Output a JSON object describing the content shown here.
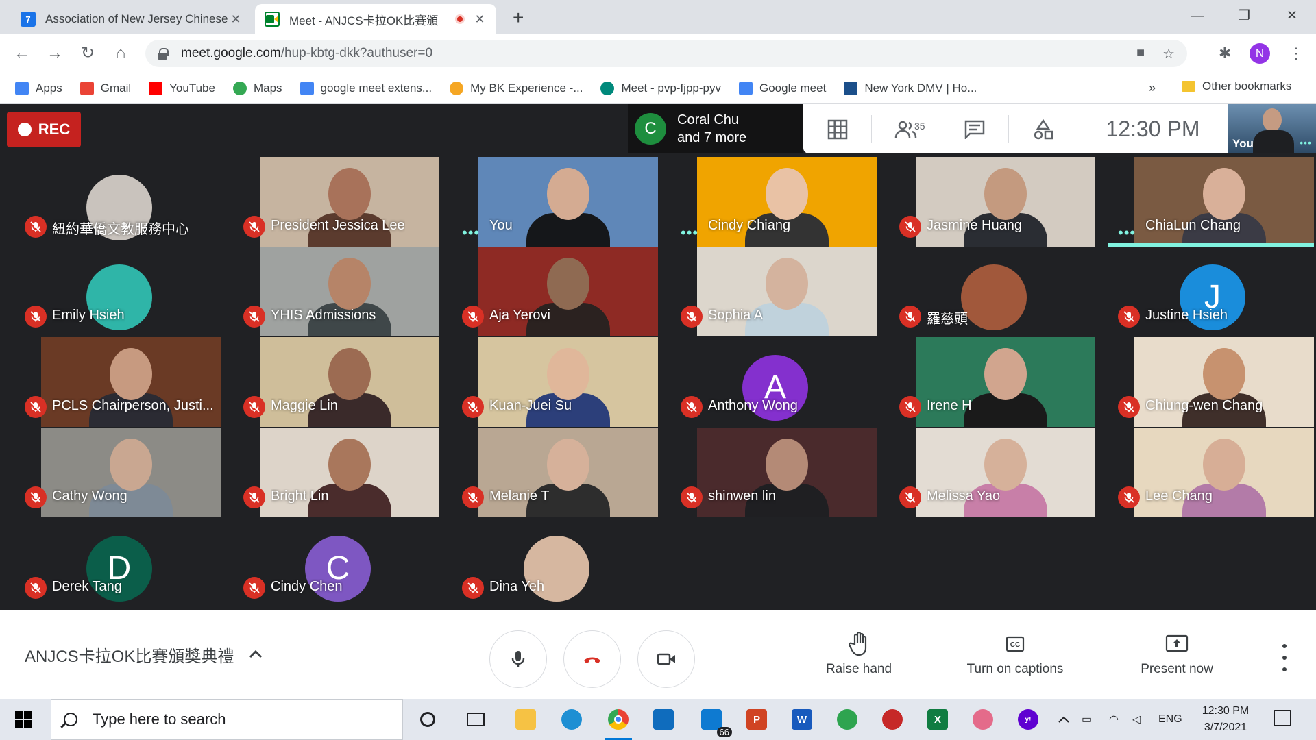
{
  "browser": {
    "tabs": [
      {
        "title": "Association of New Jersey Chinese",
        "favicon_text": "7",
        "favicon_color": "#1a73e8"
      },
      {
        "title": "Meet - ANJCS卡拉OK比賽頒",
        "favicon_text": "",
        "favicon_color": "#00832d"
      }
    ],
    "url_host": "meet.google.com",
    "url_path": "/hup-kbtg-dkk?authuser=0",
    "profile_initial": "N"
  },
  "bookmarks": [
    {
      "label": "Apps",
      "icon": "apps-grid-icon",
      "color": "#4285f4"
    },
    {
      "label": "Gmail",
      "icon": "gmail-icon",
      "color": "#ea4335"
    },
    {
      "label": "YouTube",
      "icon": "youtube-icon",
      "color": "#ff0000"
    },
    {
      "label": "Maps",
      "icon": "maps-pin-icon",
      "color": "#34a853"
    },
    {
      "label": "google meet extens...",
      "icon": "google-g-icon",
      "color": "#4285f4"
    },
    {
      "label": "My BK Experience -...",
      "icon": "bk-icon",
      "color": "#f5a623"
    },
    {
      "label": "Meet - pvp-fjpp-pyv",
      "icon": "meet-icon",
      "color": "#00897b"
    },
    {
      "label": "Google meet",
      "icon": "google-g-icon",
      "color": "#4285f4"
    },
    {
      "label": "New York DMV | Ho...",
      "icon": "ny-dmv-icon",
      "color": "#1b4f8a"
    }
  ],
  "bookmarks_more": "»",
  "other_bookmarks": "Other bookmarks",
  "meet": {
    "rec_label": "REC",
    "presenter": {
      "initial": "C",
      "line1": "Coral Chu",
      "line2": "and 7 more"
    },
    "participant_count": "35",
    "clock": "12:30  PM",
    "self_label": "You",
    "participants": [
      {
        "name": "紐約華僑文教服務中心",
        "state": "muted",
        "kind": "circle-photo",
        "color": "#c9c3bd"
      },
      {
        "name": "President Jessica Lee",
        "state": "muted",
        "kind": "video",
        "color": "#c6b4a0",
        "skin": "#a8725a",
        "shirt": "#5b3b2e"
      },
      {
        "name": "You",
        "state": "speaking",
        "kind": "video",
        "color": "#5f87b8",
        "skin": "#d4ab92",
        "shirt": "#15171a"
      },
      {
        "name": "Cindy Chiang",
        "state": "speaking",
        "kind": "video",
        "color": "#f0a400",
        "skin": "#e9c2a5",
        "shirt": "#333333"
      },
      {
        "name": "Jasmine Huang",
        "state": "muted",
        "kind": "video",
        "color": "#d3cbc1",
        "skin": "#c49a7f",
        "shirt": "#2a2d33"
      },
      {
        "name": "ChiaLun Chang",
        "state": "speaking-active",
        "kind": "video",
        "color": "#7a5a42",
        "skin": "#d9b099",
        "shirt": "#3b3b45"
      },
      {
        "name": "Emily Hsieh",
        "state": "muted",
        "kind": "circle-photo",
        "color": "#2fb5a8"
      },
      {
        "name": "YHIS Admissions",
        "state": "muted",
        "kind": "video",
        "color": "#9fa2a0",
        "skin": "#b68468",
        "shirt": "#3f4749"
      },
      {
        "name": "Aja Yerovi",
        "state": "muted",
        "kind": "video",
        "color": "#8e2a24",
        "skin": "#8f6a52",
        "shirt": "#2b2220"
      },
      {
        "name": "Sophia A",
        "state": "muted",
        "kind": "video",
        "color": "#dcd6cc",
        "skin": "#d4b39e",
        "shirt": "#c0d2dc"
      },
      {
        "name": "羅慈頭",
        "state": "muted",
        "kind": "circle-photo",
        "color": "#a1583b"
      },
      {
        "name": "Justine Hsieh",
        "state": "muted",
        "kind": "avatar",
        "color": "#1a8ddb",
        "initial": "J"
      },
      {
        "name": "PCLS Chairperson, Justi...",
        "state": "muted",
        "kind": "video",
        "color": "#6a3a25",
        "skin": "#c79a80",
        "shirt": "#2b2b33"
      },
      {
        "name": "Maggie Lin",
        "state": "muted",
        "kind": "video",
        "color": "#cfbe9a",
        "skin": "#9c6b52",
        "shirt": "#3a2a2a"
      },
      {
        "name": "Kuan-Juei Su",
        "state": "muted",
        "kind": "video",
        "color": "#d6c59f",
        "skin": "#e0b79a",
        "shirt": "#2c3f7a"
      },
      {
        "name": "Anthony Wong",
        "state": "muted",
        "kind": "avatar",
        "color": "#8430ce",
        "initial": "A"
      },
      {
        "name": "Irene H",
        "state": "muted",
        "kind": "video",
        "color": "#2c7a5a",
        "skin": "#d1a58e",
        "shirt": "#1a1a1a"
      },
      {
        "name": "Chiung-wen Chang",
        "state": "muted",
        "kind": "video",
        "color": "#e8dccb",
        "skin": "#c7926f",
        "shirt": "#3f2f2a"
      },
      {
        "name": "Cathy Wong",
        "state": "muted",
        "kind": "video",
        "color": "#8c8b86",
        "skin": "#c9a791",
        "shirt": "#7e8a96"
      },
      {
        "name": "Bright Lin",
        "state": "muted",
        "kind": "video",
        "color": "#ddd4c9",
        "skin": "#a9775c",
        "shirt": "#4a2c2c"
      },
      {
        "name": "Melanie T",
        "state": "muted",
        "kind": "video",
        "color": "#b9a793",
        "skin": "#d6b19a",
        "shirt": "#2d2d2d"
      },
      {
        "name": "shinwen lin",
        "state": "muted",
        "kind": "video",
        "color": "#4a2a2c",
        "skin": "#b48a76",
        "shirt": "#1f1f22"
      },
      {
        "name": "Melissa Yao",
        "state": "muted",
        "kind": "video",
        "color": "#e3dcd3",
        "skin": "#d6b19a",
        "shirt": "#c87fa8"
      },
      {
        "name": "Lee Chang",
        "state": "muted",
        "kind": "video",
        "color": "#e7d8bf",
        "skin": "#d7ae96",
        "shirt": "#b37ba8"
      },
      {
        "name": "Derek Tang",
        "state": "muted",
        "kind": "avatar",
        "color": "#0b5e4a",
        "initial": "D"
      },
      {
        "name": "Cindy Chen",
        "state": "muted",
        "kind": "avatar",
        "color": "#7e57c2",
        "initial": "C"
      },
      {
        "name": "Dina Yeh",
        "state": "muted",
        "kind": "circle-photo",
        "color": "#d6b7a0"
      }
    ]
  },
  "bottom": {
    "meeting_title": "ANJCS卡拉OK比賽頒獎典禮",
    "raise_hand": "Raise hand",
    "captions": "Turn on captions",
    "present": "Present now"
  },
  "taskbar": {
    "search_placeholder": "Type here to search",
    "mail_badge": "66",
    "lang": "ENG",
    "time": "12:30 PM",
    "date": "3/7/2021"
  }
}
